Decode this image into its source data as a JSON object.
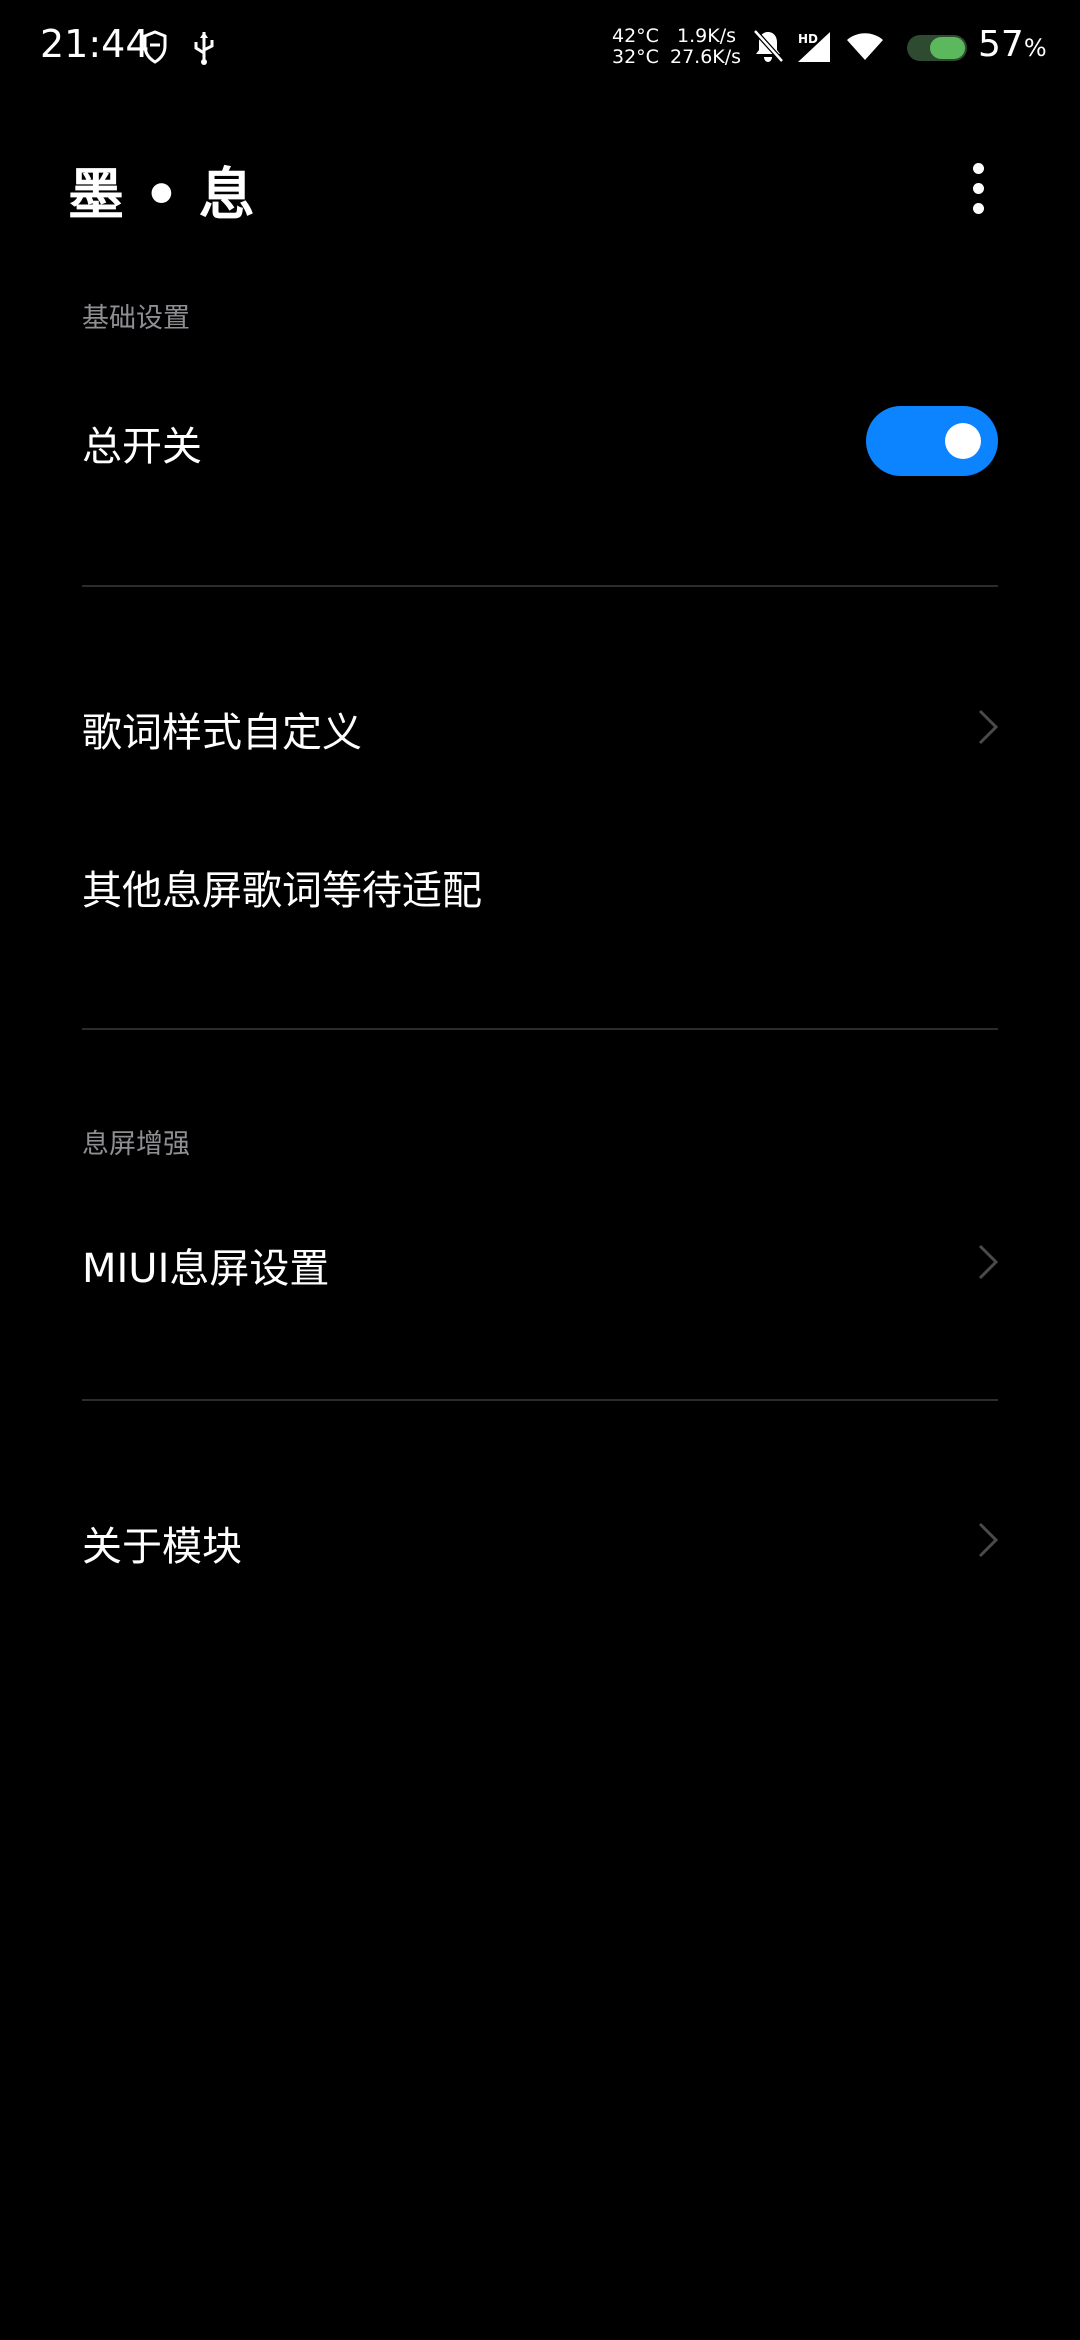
{
  "status_bar": {
    "time": "21:44",
    "temp_cpu": "42°C",
    "temp_battery": "32°C",
    "upload_speed": "1.9K/s",
    "download_speed": "27.6K/s",
    "network_badge": "HD",
    "battery_percent": "57",
    "battery_unit": "%",
    "battery_color": "#5cb85c",
    "icons": [
      "shield-icon",
      "usb-icon",
      "bell-off-icon",
      "signal-icon",
      "wifi-icon",
      "battery-icon"
    ]
  },
  "header": {
    "title": "墨 • 息",
    "more_icon": "more-vertical-icon"
  },
  "sections": {
    "basic": {
      "label": "基础设置",
      "master_switch_label": "总开关",
      "master_switch_on": true,
      "lyric_style_label": "歌词样式自定义",
      "pending_label": "其他息屏歌词等待适配"
    },
    "aod": {
      "label": "息屏增强",
      "miui_aod_label": "MIUI息屏设置"
    },
    "about": {
      "label": "关于模块"
    }
  },
  "colors": {
    "background": "#000000",
    "accent": "#0d84ff",
    "secondary_text": "#8e8e93",
    "divider": "#2c2c2e"
  }
}
